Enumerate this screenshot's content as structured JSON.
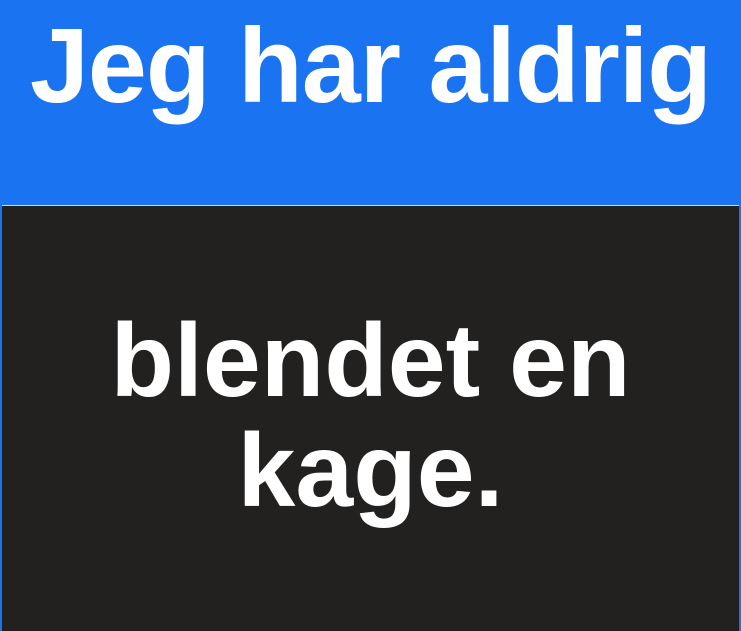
{
  "header": {
    "title": "Jeg har aldrig"
  },
  "card": {
    "line1": "blendet en",
    "line2": "kage."
  },
  "colors": {
    "header_background": "#1a73f0",
    "card_background": "#222120",
    "text": "#ffffff"
  }
}
